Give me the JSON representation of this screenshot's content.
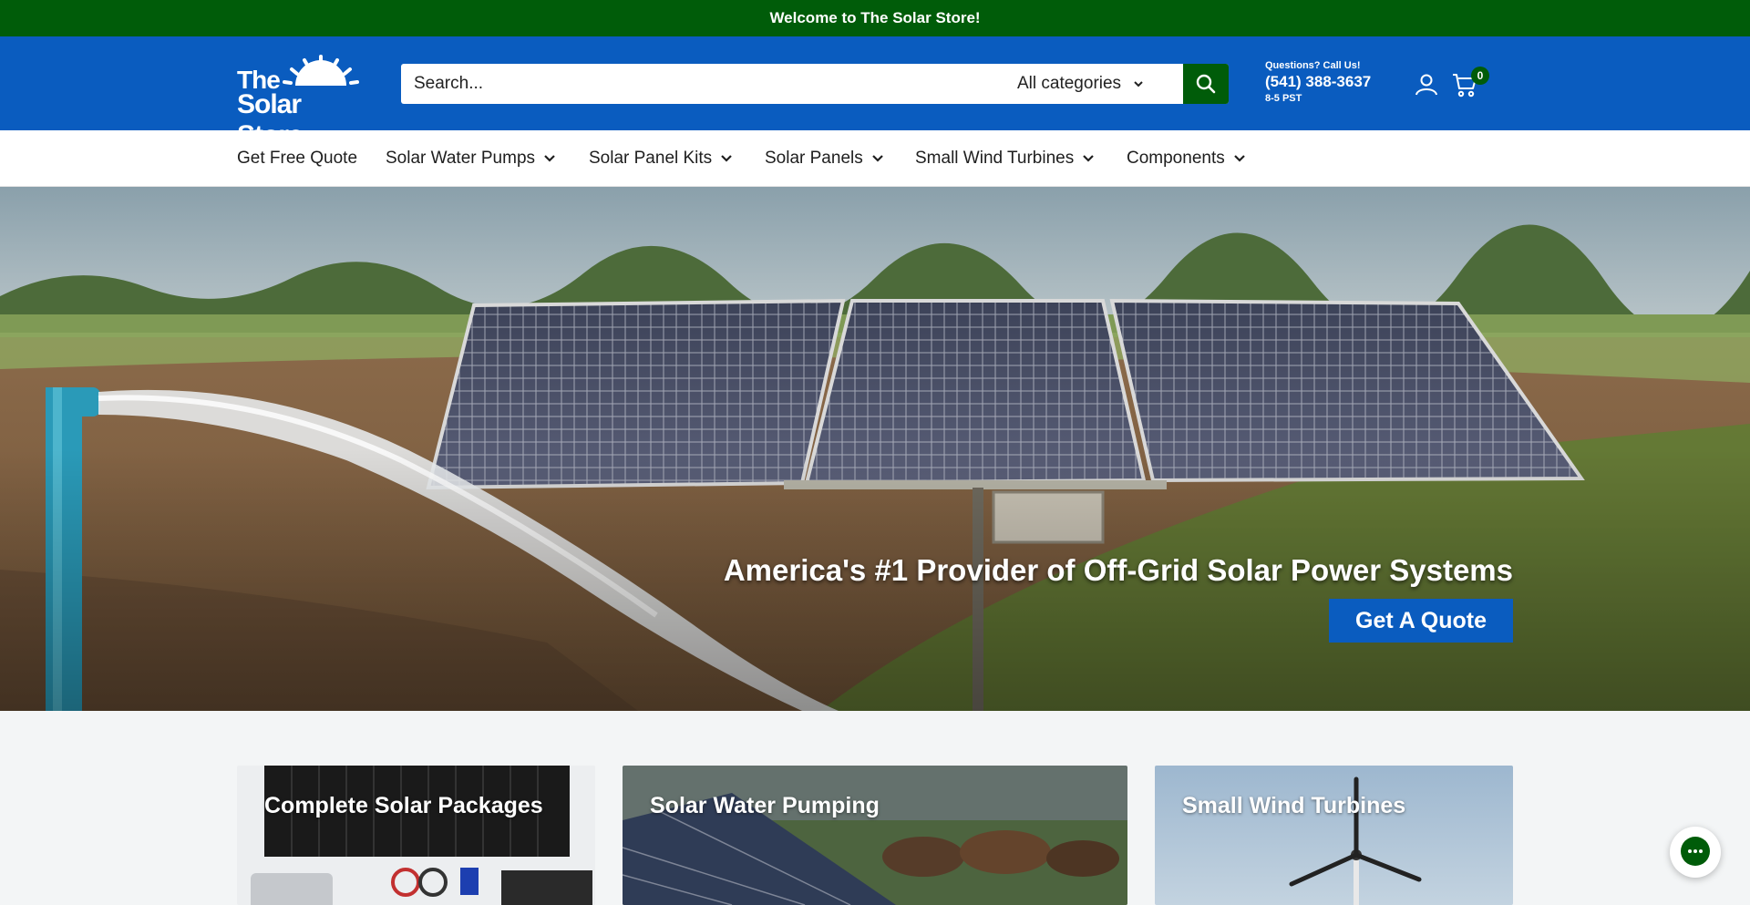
{
  "announcement": "Welcome to The Solar Store!",
  "logo": {
    "line1": "The",
    "line2": "Solar Store"
  },
  "search": {
    "placeholder": "Search...",
    "category": "All categories"
  },
  "contact": {
    "question": "Questions? Call Us!",
    "phone": "(541) 388-3637",
    "hours": "8-5 PST"
  },
  "cart": {
    "count": "0"
  },
  "nav": [
    {
      "label": "Get Free Quote"
    },
    {
      "label": "Solar Water Pumps"
    },
    {
      "label": "Solar Panel Kits"
    },
    {
      "label": "Solar Panels"
    },
    {
      "label": "Small Wind Turbines"
    },
    {
      "label": "Components"
    }
  ],
  "hero": {
    "title": "America's #1 Provider of Off-Grid Solar Power Systems",
    "button": "Get A Quote"
  },
  "cards": [
    {
      "title": "Complete Solar Packages"
    },
    {
      "title": "Solar Water Pumping"
    },
    {
      "title": "Small Wind Turbines"
    }
  ],
  "colors": {
    "brand_blue": "#0a5cbf",
    "brand_green": "#005c09"
  }
}
